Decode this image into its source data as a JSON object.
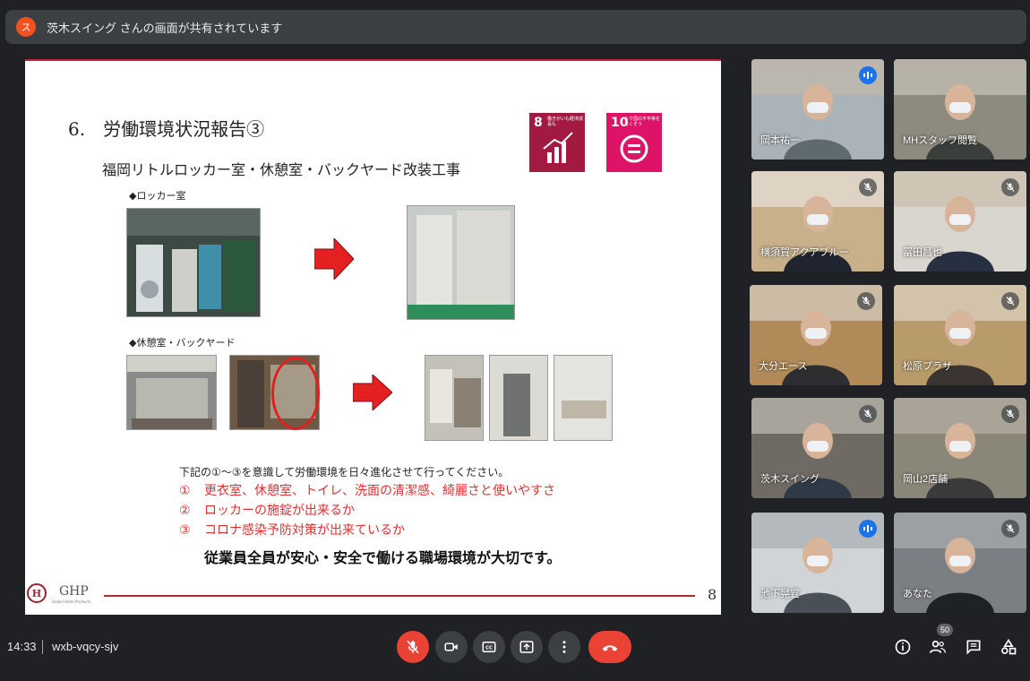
{
  "banner": {
    "avatar_letter": "ス",
    "text": "茨木スイング さんの画面が共有されています"
  },
  "slide": {
    "heading": "6.　労働環境状況報告③",
    "subheading": "福岡リトルロッカー室・休憩室・バックヤード改装工事",
    "sdg8": {
      "num": "8",
      "caption": "働きがいも経済成長も"
    },
    "sdg10": {
      "num": "10",
      "caption": "人や国の不平等をなくそう"
    },
    "section1": "◆ロッカー室",
    "section2": "◆休憩室・バックヤード",
    "note_intro": "下記の①～③を意識して労働環境を日々進化させて行ってください。",
    "notes": [
      {
        "n": "①",
        "text": "更衣室、休憩室、トイレ、洗面の清潔感、綺麗さと使いやすさ"
      },
      {
        "n": "②",
        "text": "ロッカーの施錠が出来るか"
      },
      {
        "n": "③",
        "text": "コロナ感染予防対策が出来ているか"
      }
    ],
    "bottom_message": "従業員全員が安心・安全で働ける職場環境が大切です。",
    "logo_letter": "H",
    "logo_text": "GHP",
    "logo_small": "Global Hotel Products",
    "page_number": "8"
  },
  "participants": [
    {
      "name": "岡本祐一",
      "mic": "speaking",
      "active": true
    },
    {
      "name": "MHスタッフ閲覧",
      "mic": "none",
      "active": false
    },
    {
      "name": "横須賀アクアブルー",
      "mic": "muted",
      "active": false
    },
    {
      "name": "冨田昌也",
      "mic": "muted",
      "active": false
    },
    {
      "name": "大分エース",
      "mic": "muted",
      "active": false
    },
    {
      "name": "松原プラザ",
      "mic": "muted",
      "active": false
    },
    {
      "name": "茨木スイング",
      "mic": "muted",
      "active": false
    },
    {
      "name": "岡山2店舗",
      "mic": "muted",
      "active": false
    },
    {
      "name": "池下晃宣",
      "mic": "speaking",
      "active": true
    },
    {
      "name": "あなた",
      "mic": "muted",
      "active": false
    }
  ],
  "bottombar": {
    "time": "14:33",
    "meeting_code": "wxb-vqcy-sjv",
    "participant_count": "50"
  },
  "colors": {
    "end_call": "#ea4335",
    "speaking": "#1a73e8",
    "accent_border": "#8ab4f8"
  }
}
